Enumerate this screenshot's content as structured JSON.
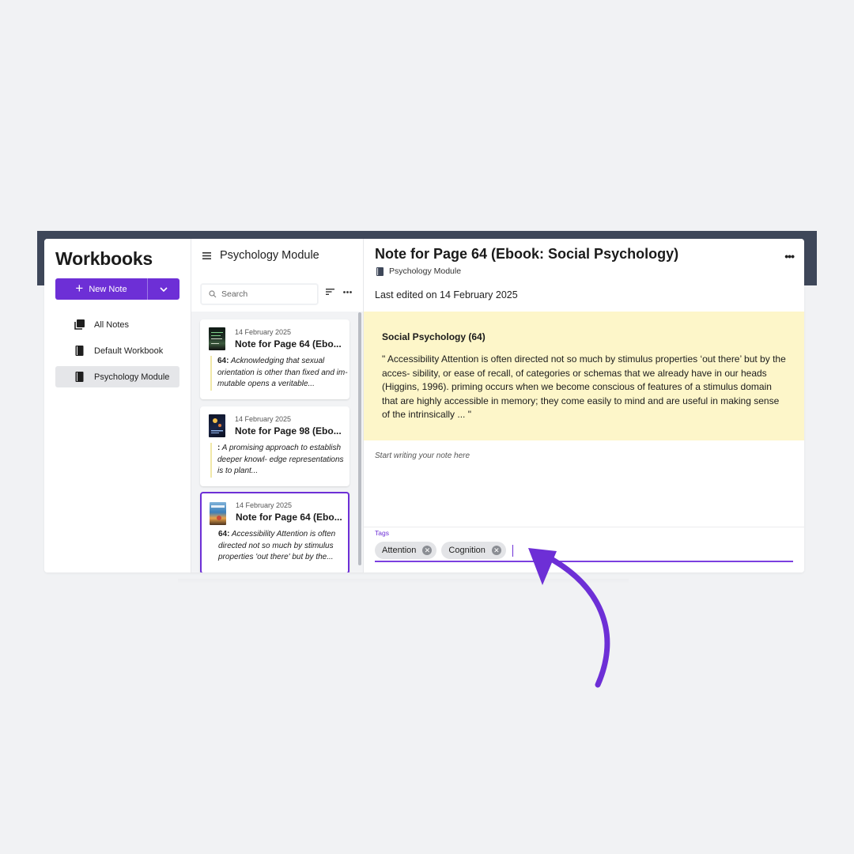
{
  "sidebar": {
    "title": "Workbooks",
    "new_note_label": "New Note",
    "items": [
      {
        "label": "All Notes",
        "icon": "stack-icon",
        "active": false
      },
      {
        "label": "Default Workbook",
        "icon": "book-icon",
        "active": false
      },
      {
        "label": "Psychology Module",
        "icon": "book-icon",
        "active": true
      }
    ]
  },
  "list": {
    "title": "Psychology Module",
    "search_placeholder": "Search",
    "notes": [
      {
        "date": "14 February 2025",
        "title": "Note for Page 64 (Ebo...",
        "page_ref": "64:",
        "excerpt": " Acknowledging that sexual orientation is other than fixed and im- mutable opens a veritable..."
      },
      {
        "date": "14 February 2025",
        "title": "Note for Page 98 (Ebo...",
        "page_ref": ":",
        "excerpt": " A promising approach to establish deeper knowl- edge representations is to plant..."
      },
      {
        "date": "14 February 2025",
        "title": "Note for Page 64 (Ebo...",
        "page_ref": "64:",
        "excerpt": " Accessibility Attention is often directed not so much by stimulus properties 'out there' but by the..."
      }
    ]
  },
  "detail": {
    "title": "Note for Page 64 (Ebook: Social Psychology)",
    "workbook": "Psychology Module",
    "last_edited": "Last edited on 14 February 2025",
    "quote_heading": "Social Psychology (64)",
    "quote_text": "\"  Accessibility Attention is often directed not so much by stimulus properties ‘out there’ but by the acces- sibility, or ease of recall, of categories or schemas that we already have in our heads (Higgins, 1996). priming occurs when we become conscious of features of a stimulus domain that are highly accessible in memory; they come easily to mind and are useful in making sense of the intrinsically ...  \"",
    "note_placeholder": "Start writing your note here",
    "tags_label": "Tags",
    "tags": [
      "Attention",
      "Cognition"
    ]
  },
  "colors": {
    "accent": "#6d2fd6",
    "topbar": "#3e4759",
    "quote_bg": "#fdf6c9",
    "page_bg": "#f1f2f4"
  }
}
